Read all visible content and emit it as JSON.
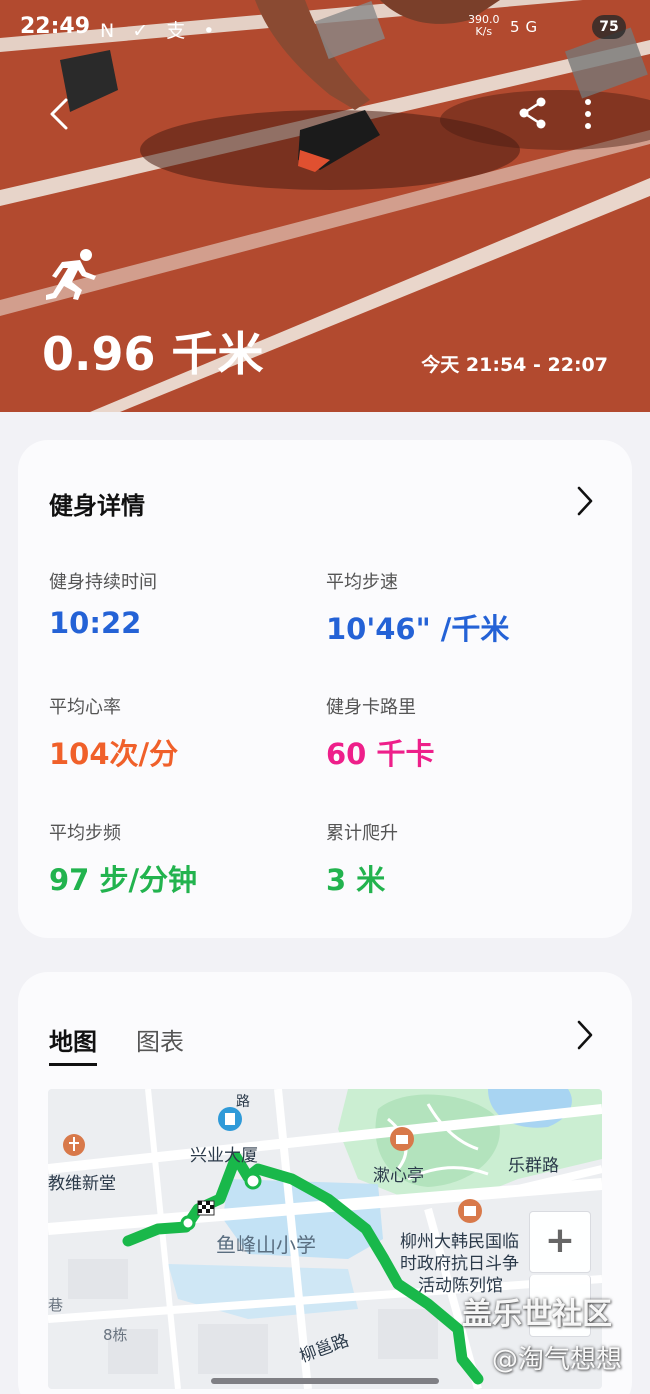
{
  "status_bar": {
    "time": "22:49",
    "left_icons": "N ✓ 支 •",
    "net_speed_value": "390.0",
    "net_speed_unit": "K/s",
    "network": "5G",
    "battery": "75"
  },
  "hero": {
    "distance": "0.96 千米",
    "time_range": "今天 21:54 - 22:07",
    "activity_icon": "running-icon"
  },
  "details_card": {
    "title": "健身详情",
    "stats": [
      {
        "label": "健身持续时间",
        "value": "10:22",
        "color": "#2462d6"
      },
      {
        "label": "平均步速",
        "value": "10'46\" /千米",
        "color": "#2462d6"
      },
      {
        "label": "平均心率",
        "value": "104次/分",
        "color": "#f0602a"
      },
      {
        "label": "健身卡路里",
        "value": "60 千卡",
        "color": "#ee1f8a"
      },
      {
        "label": "平均步频",
        "value": "97 步/分钟",
        "color": "#22b34e"
      },
      {
        "label": "累计爬升",
        "value": "3 米",
        "color": "#22b34e"
      }
    ]
  },
  "map_card": {
    "tabs": [
      "地图",
      "图表"
    ],
    "active_tab": "地图",
    "map_labels": {
      "building1": "兴业大厦",
      "church": "教维新堂",
      "pavilion": "漱心亭",
      "road1": "乐群路",
      "school": "鱼峰山小学",
      "museum": "柳州大韩民国临时政府抗日斗争活动陈列馆",
      "museum_line1": "柳州大韩民国临",
      "museum_line2": "时政府抗日斗争",
      "museum_line3": "活动陈列馆",
      "road2": "柳邕路",
      "building2": "8栋",
      "lane": "巷",
      "road_top": "路"
    },
    "zoom_in": "+",
    "route_color": "#19b84a"
  },
  "watermark": {
    "line1": "盖乐世社区",
    "line2": "@淘气想想"
  }
}
